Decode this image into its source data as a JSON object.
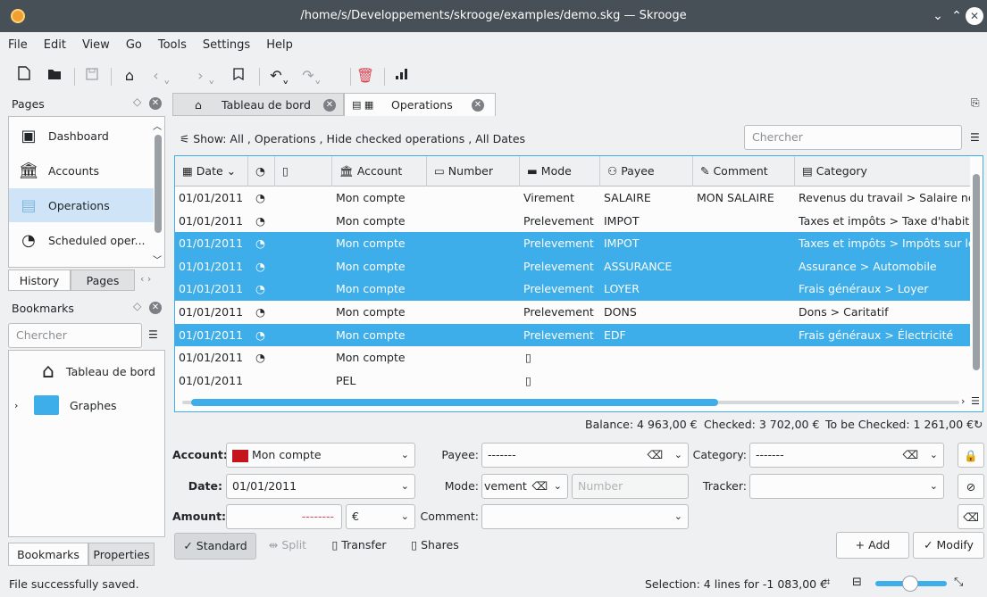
{
  "window": {
    "title": "/home/s/Developpements/skrooge/examples/demo.skg — Skrooge"
  },
  "menu": [
    "File",
    "Edit",
    "View",
    "Go",
    "Tools",
    "Settings",
    "Help"
  ],
  "pages": {
    "header": "Pages",
    "items": [
      {
        "label": "Dashboard",
        "icon": "dashboard-icon"
      },
      {
        "label": "Accounts",
        "icon": "bank-icon"
      },
      {
        "label": "Operations",
        "icon": "operations-icon"
      },
      {
        "label": "Scheduled oper...",
        "icon": "scheduled-icon"
      }
    ],
    "bottom_tabs": [
      "History",
      "Pages"
    ]
  },
  "bookmarks": {
    "header": "Bookmarks",
    "search_placeholder": "Chercher",
    "items": [
      {
        "label": "Tableau de bord"
      },
      {
        "label": "Graphes"
      }
    ]
  },
  "left_bottom_tabs": [
    "Bookmarks",
    "Properties"
  ],
  "doc_tabs": [
    {
      "label": "Tableau de bord"
    },
    {
      "label": "Operations"
    }
  ],
  "filter": {
    "text": "Show: All , Operations , Hide checked operations , All Dates",
    "search_placeholder": "Chercher"
  },
  "columns": [
    "Date",
    "",
    "",
    "Account",
    "Number",
    "Mode",
    "Payee",
    "Comment",
    "Category"
  ],
  "rows": [
    {
      "date": "01/01/2011",
      "account": "Mon compte",
      "number": "",
      "mode": "Virement",
      "payee": "SALAIRE",
      "comment": "MON SALAIRE",
      "category": "Revenus du travail > Salaire net",
      "selected": false,
      "recurrent": true,
      "doc": false
    },
    {
      "date": "01/01/2011",
      "account": "Mon compte",
      "number": "",
      "mode": "Prelevement",
      "payee": "IMPOT",
      "comment": "",
      "category": "Taxes et impôts > Taxe d'habita",
      "selected": false,
      "recurrent": true,
      "doc": false
    },
    {
      "date": "01/01/2011",
      "account": "Mon compte",
      "number": "",
      "mode": "Prelevement",
      "payee": "IMPOT",
      "comment": "",
      "category": "Taxes et impôts > Impôts sur le",
      "selected": true,
      "recurrent": true,
      "doc": false
    },
    {
      "date": "01/01/2011",
      "account": "Mon compte",
      "number": "",
      "mode": "Prelevement",
      "payee": "ASSURANCE",
      "comment": "",
      "category": "Assurance > Automobile",
      "selected": true,
      "recurrent": true,
      "doc": false
    },
    {
      "date": "01/01/2011",
      "account": "Mon compte",
      "number": "",
      "mode": "Prelevement",
      "payee": "LOYER",
      "comment": "",
      "category": "Frais généraux > Loyer",
      "selected": true,
      "recurrent": true,
      "doc": false
    },
    {
      "date": "01/01/2011",
      "account": "Mon compte",
      "number": "",
      "mode": "Prelevement",
      "payee": "DONS",
      "comment": "",
      "category": "Dons > Caritatif",
      "selected": false,
      "recurrent": true,
      "doc": false
    },
    {
      "date": "01/01/2011",
      "account": "Mon compte",
      "number": "",
      "mode": "Prelevement",
      "payee": "EDF",
      "comment": "",
      "category": "Frais généraux > Électricité",
      "selected": true,
      "recurrent": true,
      "doc": false
    },
    {
      "date": "01/01/2011",
      "account": "Mon compte",
      "number": "",
      "mode": "",
      "payee": "",
      "comment": "",
      "category": "",
      "selected": false,
      "recurrent": true,
      "doc": true
    },
    {
      "date": "01/01/2011",
      "account": "PEL",
      "number": "",
      "mode": "",
      "payee": "",
      "comment": "",
      "category": "",
      "selected": false,
      "recurrent": false,
      "doc": true
    }
  ],
  "summary": {
    "balance": "Balance: 4 963,00 €",
    "checked": "Checked: 3 702,00 €",
    "to_be_checked": "To be Checked: 1 261,00 €"
  },
  "form": {
    "account_label": "Account:",
    "account_value": "Mon compte",
    "date_label": "Date:",
    "date_value": "01/01/2011",
    "amount_label": "Amount:",
    "amount_value": "--------",
    "currency": "€",
    "payee_label": "Payee:",
    "payee_value": "-------",
    "mode_label": "Mode:",
    "mode_value": "vement",
    "number_placeholder": "Number",
    "comment_label": "Comment:",
    "comment_value": "",
    "category_label": "Category:",
    "category_value": "-------",
    "tracker_label": "Tracker:",
    "tracker_value": ""
  },
  "form_tabs": {
    "standard": "Standard",
    "split": "Split",
    "transfer": "Transfer",
    "shares": "Shares"
  },
  "actions": {
    "add": "Add",
    "modify": "Modify"
  },
  "status": {
    "message": "File successfully saved.",
    "selection": "Selection: 4 lines for -1 083,00 €"
  },
  "colors": {
    "accent": "#3daee9",
    "titlebar": "#475057",
    "selection": "#3daee9",
    "amount_red": "#da4453"
  }
}
